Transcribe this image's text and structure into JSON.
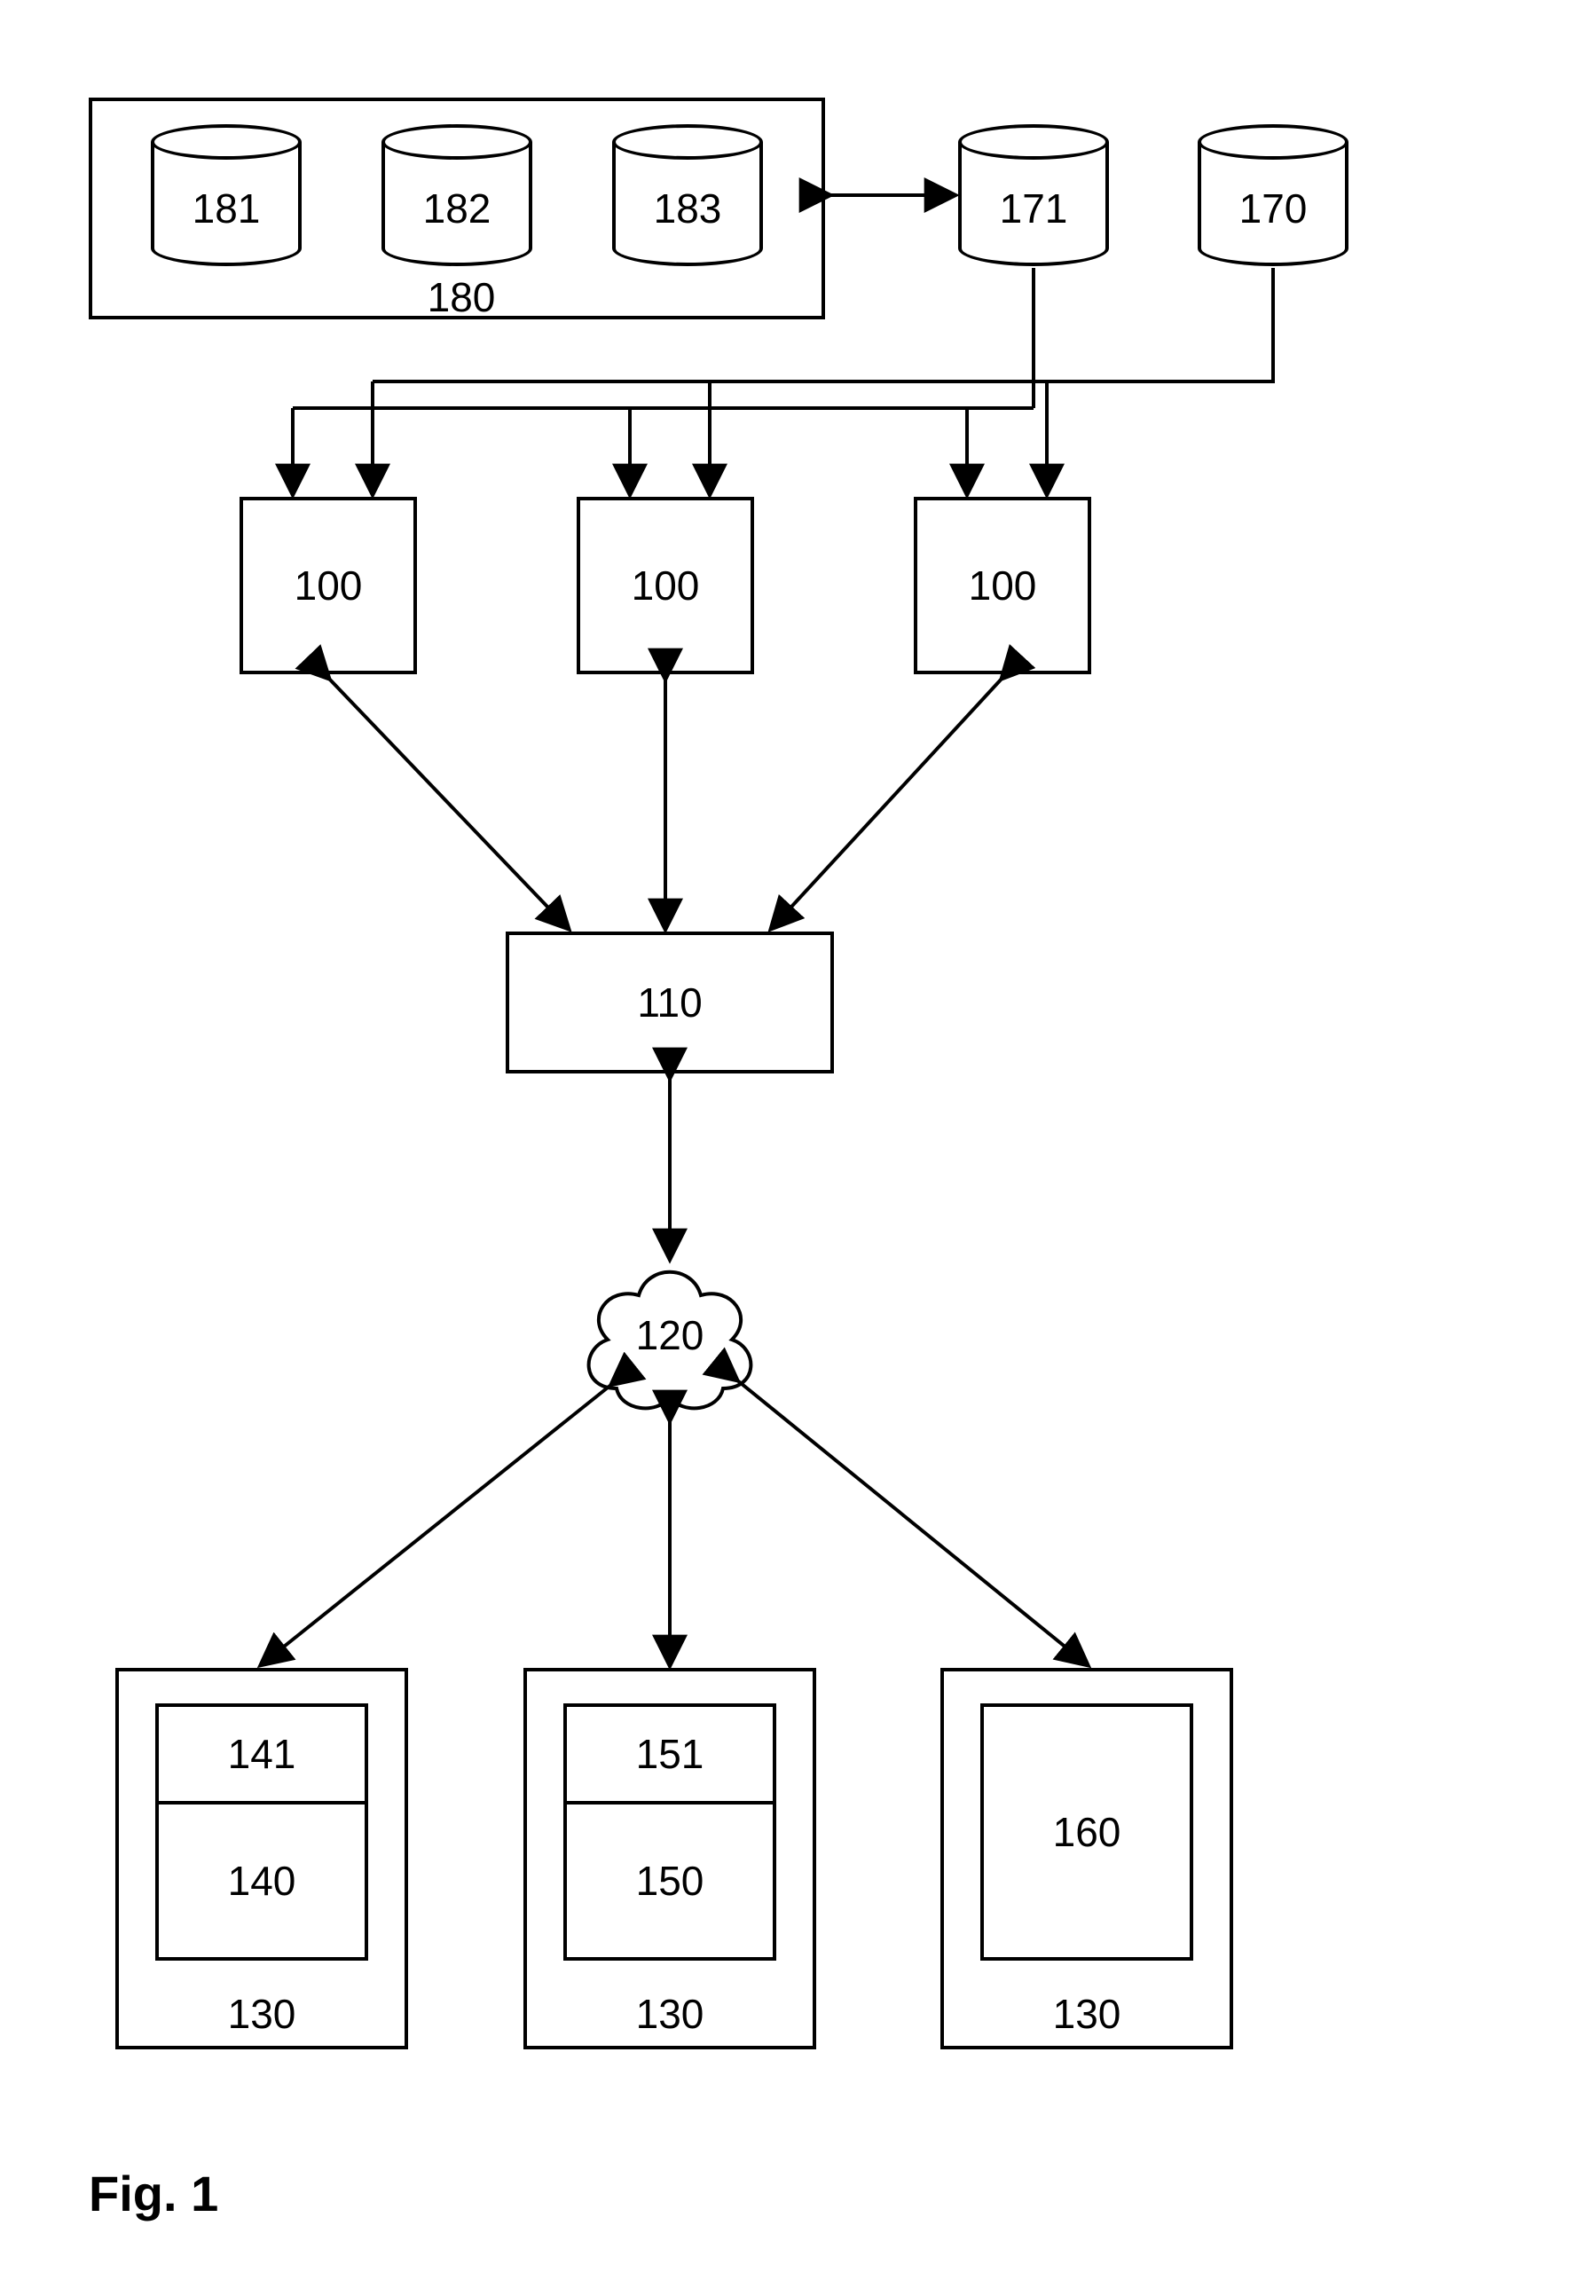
{
  "figure_caption": "Fig. 1",
  "container_180": {
    "label": "180",
    "databases": {
      "db181": "181",
      "db182": "182",
      "db183": "183"
    }
  },
  "db171": "171",
  "db170": "170",
  "servers_100": {
    "left": "100",
    "mid": "100",
    "right": "100"
  },
  "box110": "110",
  "cloud120": "120",
  "clients_130": {
    "left": {
      "outer": "130",
      "lower": "140",
      "upper": "141"
    },
    "mid": {
      "outer": "130",
      "lower": "150",
      "upper": "151"
    },
    "right": {
      "outer": "130",
      "inner": "160"
    }
  }
}
